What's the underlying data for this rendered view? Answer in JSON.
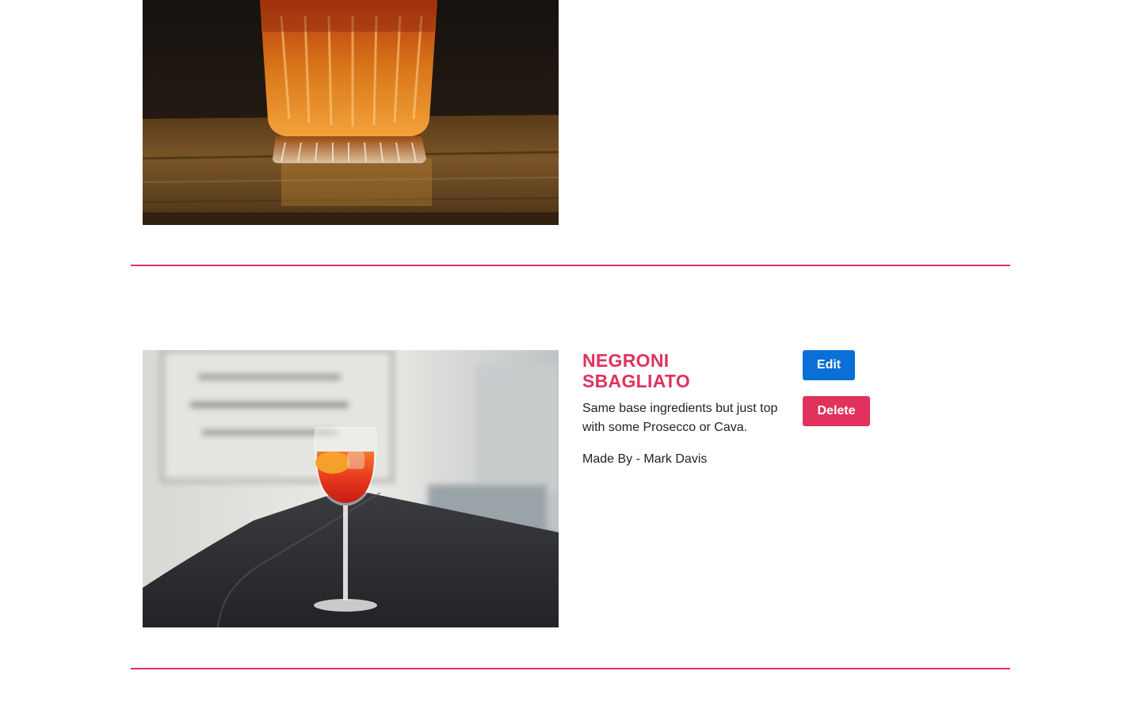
{
  "recipes": [
    {
      "image_icon": "old-fashioned-cocktail-photo"
    },
    {
      "image_icon": "spritz-cocktail-photo",
      "title": "NEGRONI SBAGLIATO",
      "description": "Same base ingredients but just top with some Prosecco or Cava.",
      "author_prefix": "Made By - ",
      "author": "Mark Davis",
      "edit_label": "Edit",
      "delete_label": "Delete"
    }
  ],
  "colors": {
    "accent": "#e0325c",
    "edit_button": "#0a6fd6",
    "text": "#222222"
  }
}
